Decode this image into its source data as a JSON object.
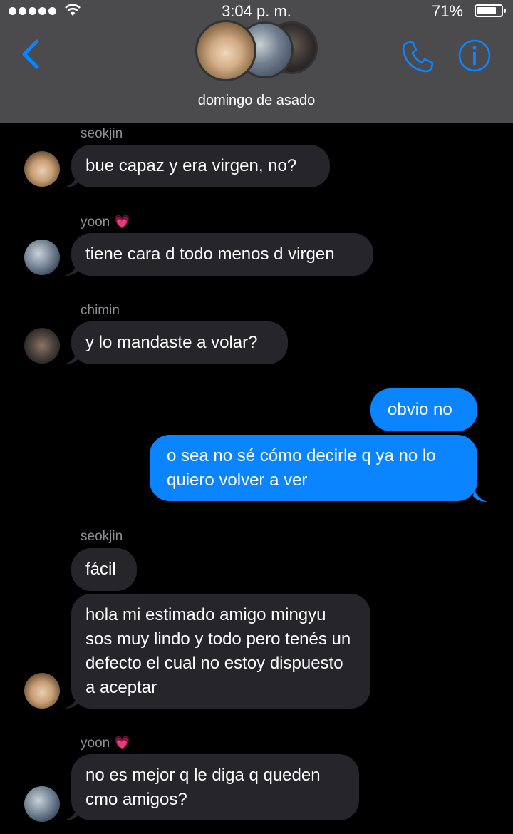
{
  "status_bar": {
    "time": "3:04 p. m.",
    "battery": "71%",
    "battery_level": 0.71
  },
  "header": {
    "group_name": "domingo de asado",
    "icons": [
      "back-chevron-icon",
      "phone-icon",
      "info-icon"
    ]
  },
  "colors": {
    "header_bg": "#4b4b4d",
    "accent": "#0a84ff",
    "incoming_bubble": "#26252a",
    "outgoing_bubble": "#0a84ff",
    "heart": "#ff4f9a"
  },
  "messages": [
    {
      "sender": "seokjin",
      "heart": "",
      "text": "bue capaz y era virgen, no?"
    },
    {
      "sender": "yoon",
      "heart": "💗",
      "text": "tiene cara d todo menos d virgen"
    },
    {
      "sender": "chimin",
      "heart": "",
      "text": "y lo mandaste a volar?"
    },
    {
      "sender": "me",
      "text": "obvio no"
    },
    {
      "sender": "me",
      "text": "o sea no sé cómo decirle q ya no lo quiero volver a ver"
    },
    {
      "sender": "seokjin",
      "heart": "",
      "text": "fácil"
    },
    {
      "sender": "seokjin",
      "text": "hola mi estimado amigo mingyu sos muy lindo y todo pero tenés un defecto el cual no estoy dispuesto a aceptar"
    },
    {
      "sender": "yoon",
      "heart": "💗",
      "text": "no es mejor q le diga q queden cmo amigos?"
    }
  ]
}
